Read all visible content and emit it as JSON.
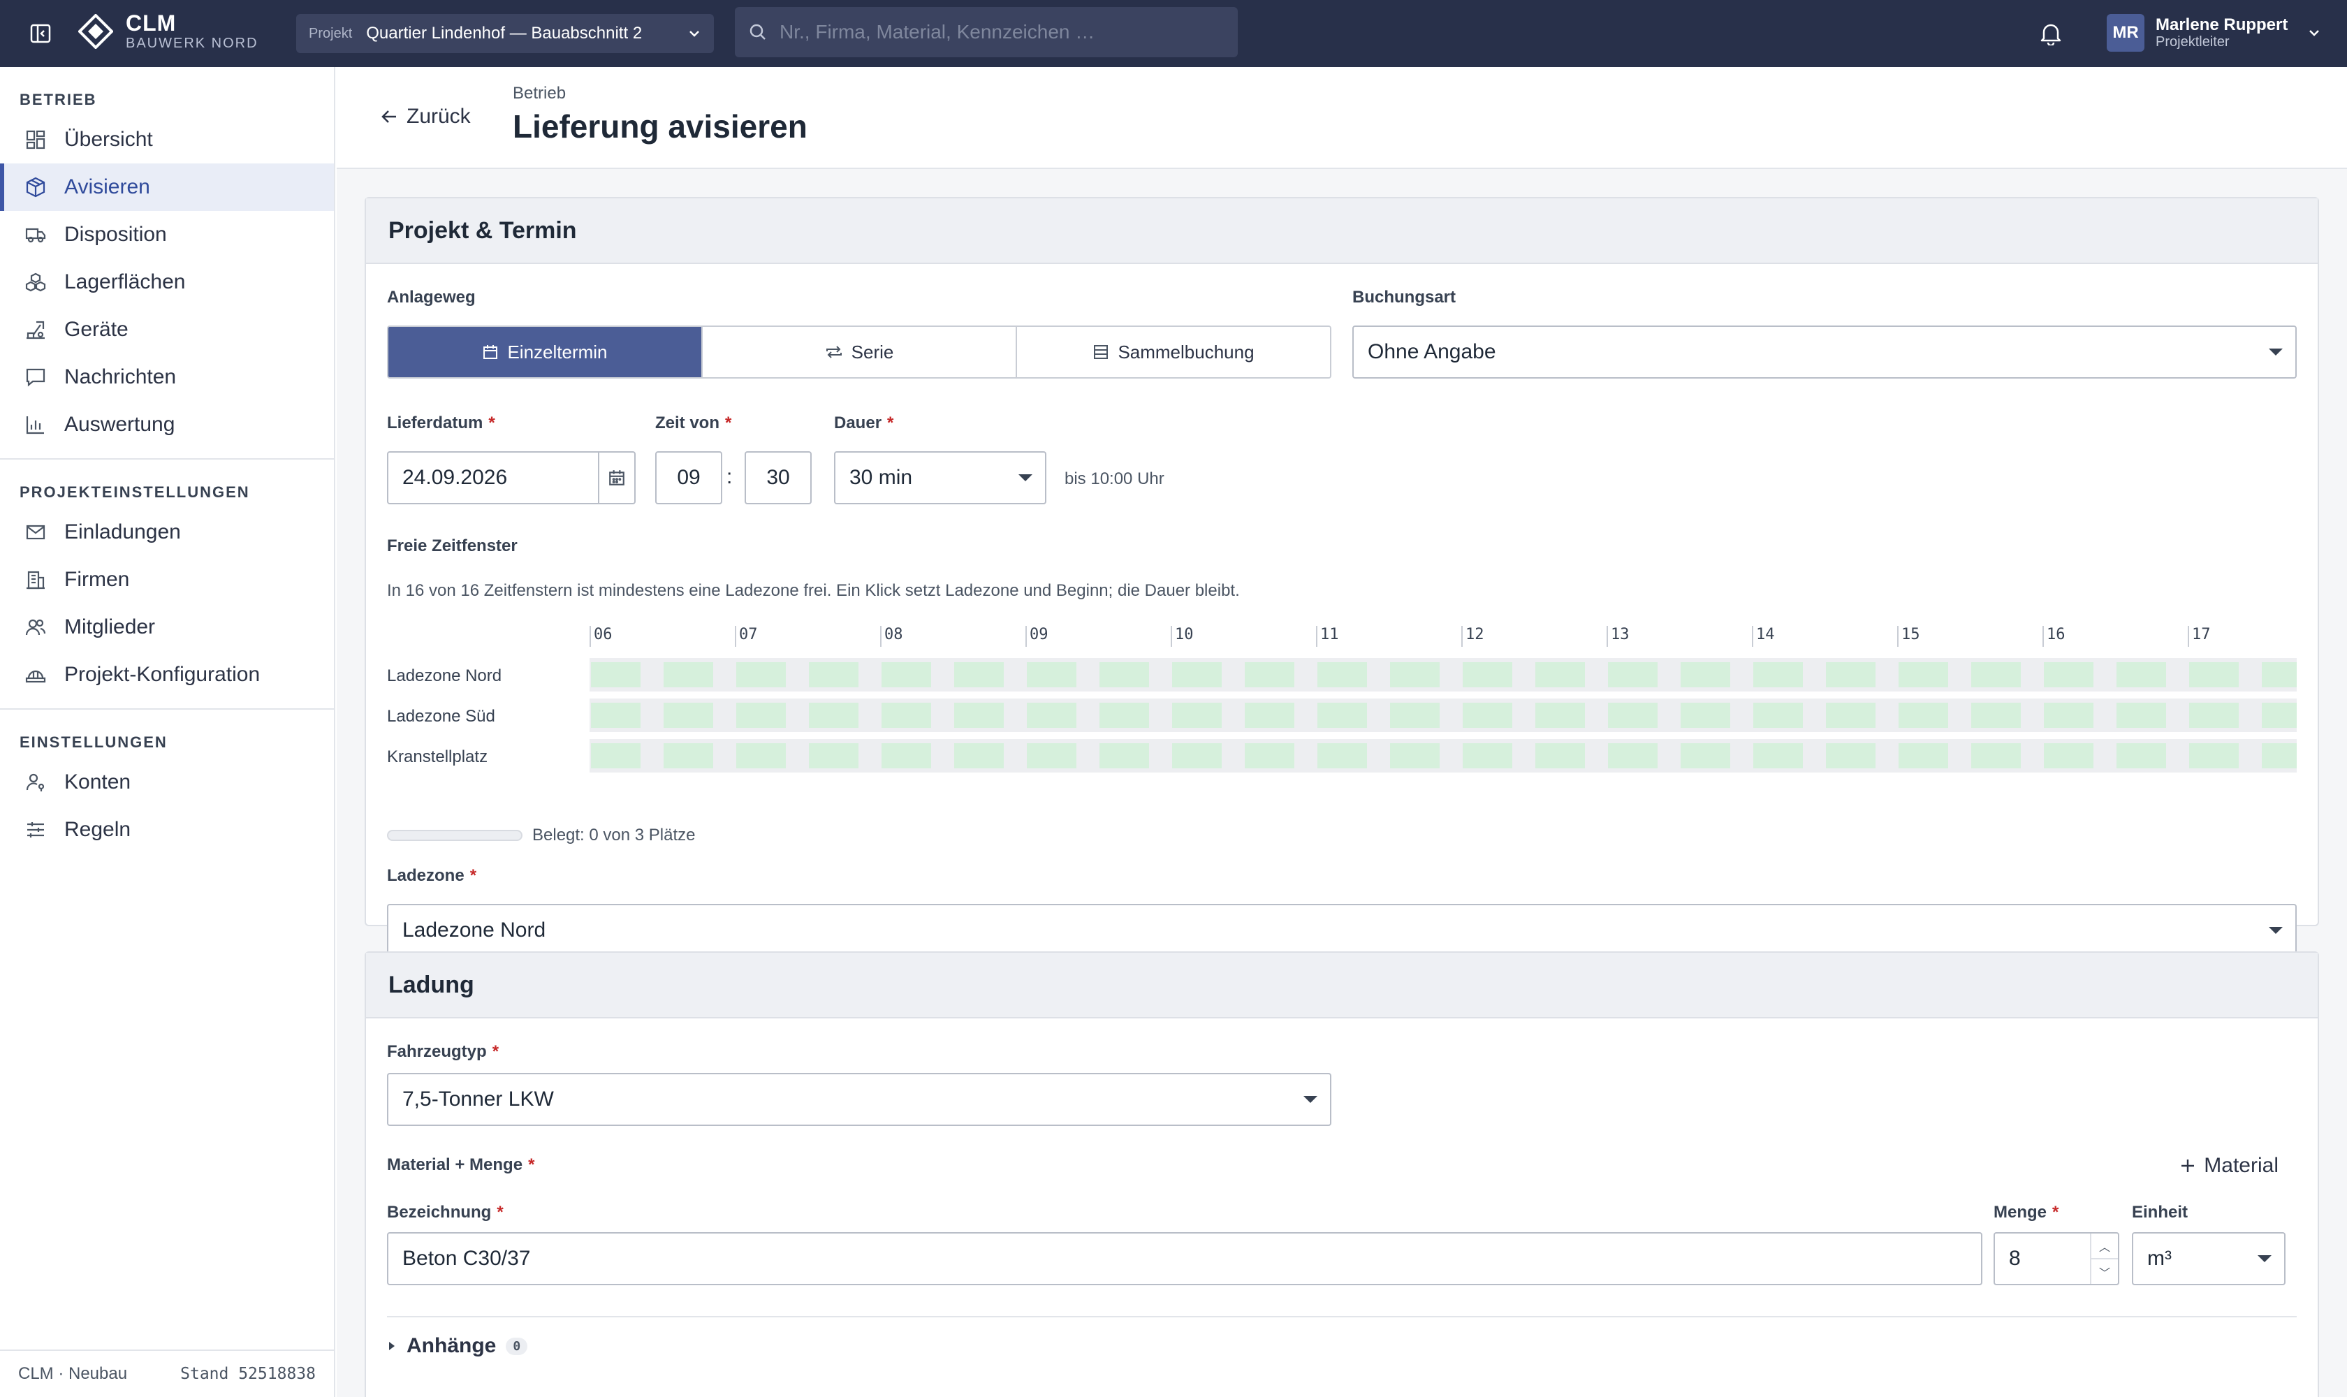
{
  "topbar": {
    "brand_title": "CLM",
    "brand_subtitle": "BAUWERK NORD",
    "project_label": "Projekt",
    "project_value": "Quartier Lindenhof — Bauabschnitt 2",
    "search_placeholder": "Nr., Firma, Material, Kennzeichen …",
    "user_initials": "MR",
    "user_name": "Marlene Ruppert",
    "user_role": "Projektleiter"
  },
  "sidebar": {
    "sections": [
      {
        "title": "BETRIEB",
        "items": [
          {
            "label": "Übersicht",
            "icon": "dashboard-icon"
          },
          {
            "label": "Avisieren",
            "icon": "package-icon",
            "active": true
          },
          {
            "label": "Disposition",
            "icon": "truck-icon"
          },
          {
            "label": "Lagerflächen",
            "icon": "boxes-icon"
          },
          {
            "label": "Geräte",
            "icon": "crane-icon"
          },
          {
            "label": "Nachrichten",
            "icon": "message-icon"
          },
          {
            "label": "Auswertung",
            "icon": "bar-chart-icon"
          }
        ]
      },
      {
        "title": "PROJEKTEINSTELLUNGEN",
        "items": [
          {
            "label": "Einladungen",
            "icon": "mail-icon"
          },
          {
            "label": "Firmen",
            "icon": "building-icon"
          },
          {
            "label": "Mitglieder",
            "icon": "users-icon"
          },
          {
            "label": "Projekt-Konfiguration",
            "icon": "hardhat-icon"
          }
        ]
      },
      {
        "title": "EINSTELLUNGEN",
        "items": [
          {
            "label": "Konten",
            "icon": "user-key-icon"
          },
          {
            "label": "Regeln",
            "icon": "sliders-icon"
          }
        ]
      }
    ],
    "footer_left": "CLM · Neubau",
    "footer_right": "Stand 52518838"
  },
  "page": {
    "back_label": "Zurück",
    "breadcrumb": "Betrieb",
    "title": "Lieferung avisieren"
  },
  "card1": {
    "title": "Projekt & Termin",
    "anlageweg_label": "Anlageweg",
    "segments": [
      {
        "label": "Einzeltermin",
        "icon": "calendar-icon",
        "active": true
      },
      {
        "label": "Serie",
        "icon": "repeat-icon"
      },
      {
        "label": "Sammelbuchung",
        "icon": "list-icon"
      }
    ],
    "buchungsart_label": "Buchungsart",
    "buchungsart_value": "Ohne Angabe",
    "lieferdatum_label": "Lieferdatum",
    "lieferdatum_value": "24.09.2026",
    "zeit_label": "Zeit von",
    "zeit_hour": "09",
    "zeit_sep": ":",
    "zeit_minute": "30",
    "dauer_label": "Dauer",
    "dauer_value": "30 min",
    "bis_text": "bis 10:00 Uhr",
    "freie_label": "Freie Zeitfenster",
    "freie_hint": "In 16 von 16 Zeitfenstern ist mindestens eine Ladezone frei. Ein Klick setzt Ladezone und Beginn; die Dauer bleibt.",
    "hours": [
      "06",
      "07",
      "08",
      "09",
      "10",
      "11",
      "12",
      "13",
      "14",
      "15",
      "16",
      "17"
    ],
    "zones": [
      "Ladezone Nord",
      "Ladezone Süd",
      "Kranstellplatz"
    ],
    "belegt_text": "Belegt: 0 von 3 Plätze",
    "belegt_fraction": 0,
    "ladezone_label": "Ladezone",
    "ladezone_value": "Ladezone Nord"
  },
  "card2": {
    "title": "Ladung",
    "fahrzeug_label": "Fahrzeugtyp",
    "fahrzeug_value": "7,5-Tonner LKW",
    "material_label": "Material + Menge",
    "add_material": "Material",
    "bezeichnung_label": "Bezeichnung",
    "bezeichnung_value": "Beton C30/37",
    "menge_label": "Menge",
    "menge_value": "8",
    "einheit_label": "Einheit",
    "einheit_value": "m³",
    "anhaenge_label": "Anhänge",
    "anhaenge_count": "0"
  }
}
